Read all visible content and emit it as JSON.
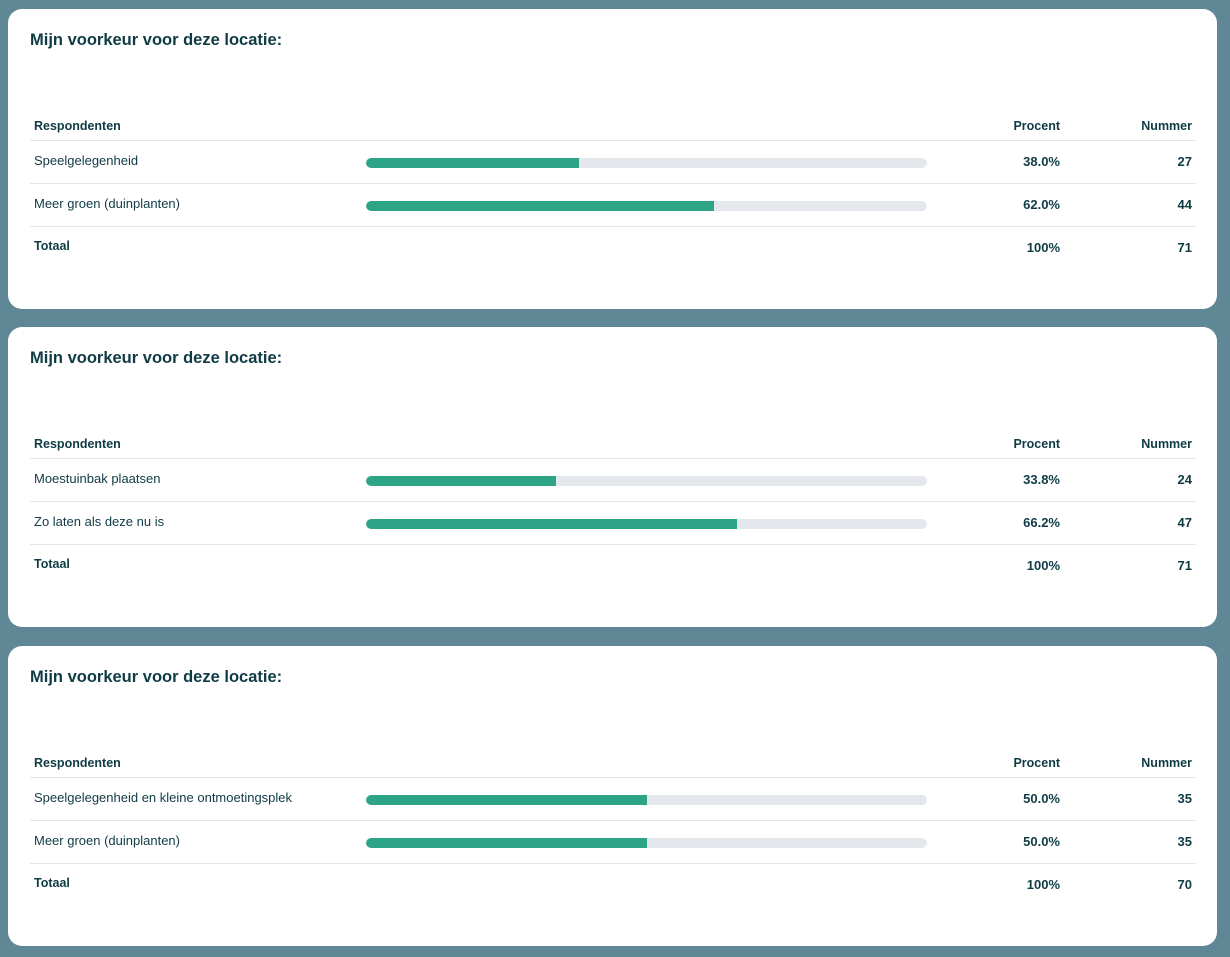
{
  "colors": {
    "background": "#5f8796",
    "card": "#ffffff",
    "text": "#0f3b45",
    "bar_fill": "#2ea486",
    "bar_track": "#e4e8ec"
  },
  "cards": [
    {
      "title": "Mijn voorkeur voor deze locatie:",
      "header": {
        "respondents": "Respondenten",
        "percent": "Procent",
        "number": "Nummer"
      },
      "rows": [
        {
          "label": "Speelgelegenheid",
          "percent": "38.0%",
          "number": "27",
          "fraction": 0.38
        },
        {
          "label": "Meer groen (duinplanten)",
          "percent": "62.0%",
          "number": "44",
          "fraction": 0.62
        }
      ],
      "total": {
        "label": "Totaal",
        "percent": "100%",
        "number": "71"
      }
    },
    {
      "title": "Mijn voorkeur voor deze locatie:",
      "header": {
        "respondents": "Respondenten",
        "percent": "Procent",
        "number": "Nummer"
      },
      "rows": [
        {
          "label": "Moestuinbak plaatsen",
          "percent": "33.8%",
          "number": "24",
          "fraction": 0.338
        },
        {
          "label": "Zo laten als deze nu is",
          "percent": "66.2%",
          "number": "47",
          "fraction": 0.662
        }
      ],
      "total": {
        "label": "Totaal",
        "percent": "100%",
        "number": "71"
      }
    },
    {
      "title": "Mijn voorkeur voor deze locatie:",
      "header": {
        "respondents": "Respondenten",
        "percent": "Procent",
        "number": "Nummer"
      },
      "rows": [
        {
          "label": "Speelgelegenheid en kleine ontmoetingsplek",
          "percent": "50.0%",
          "number": "35",
          "fraction": 0.5
        },
        {
          "label": "Meer groen (duinplanten)",
          "percent": "50.0%",
          "number": "35",
          "fraction": 0.5
        }
      ],
      "total": {
        "label": "Totaal",
        "percent": "100%",
        "number": "70"
      }
    }
  ]
}
